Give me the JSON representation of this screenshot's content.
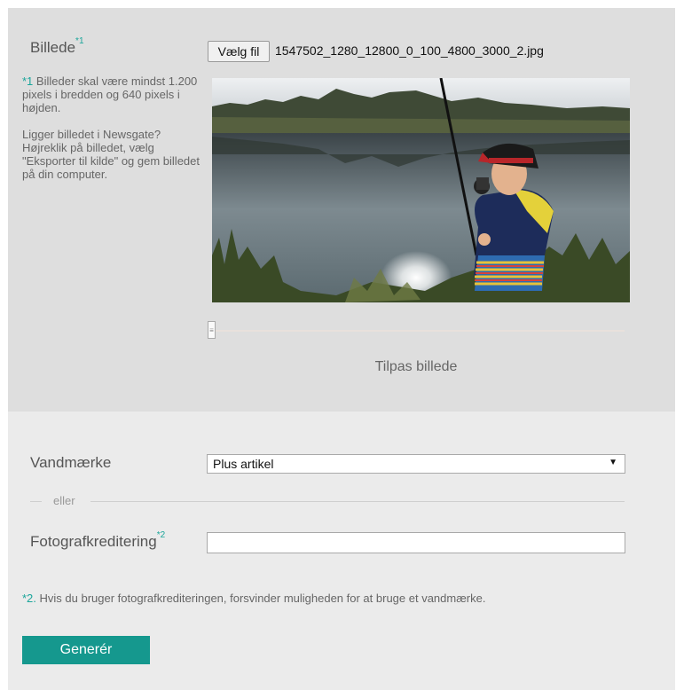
{
  "image_section": {
    "label": "Billede",
    "label_note": "*1",
    "help_note_marker": "*1",
    "help_text_1": "Billeder skal være mindst 1.200 pixels i bredden og 640 pixels i højden.",
    "help_text_2": "Ligger billedet i Newsgate? Højreklik på billedet, vælg \"Eksporter til kilde\" og gem billedet på din computer.",
    "file_button_label": "Vælg fil",
    "file_name": "1547502_1280_12800_0_100_4800_3000_2.jpg",
    "slider_handle_glyph": "≡",
    "fit_label": "Tilpas billede"
  },
  "watermark": {
    "label": "Vandmærke",
    "selected": "Plus artikel",
    "caret_glyph": "▼"
  },
  "divider": {
    "dash": "—",
    "text": "eller"
  },
  "photo_credit": {
    "label": "Fotografkreditering",
    "label_note": "*2",
    "value": ""
  },
  "footnote": {
    "marker": "*2.",
    "text": " Hvis du bruger fotografkrediteringen, forsvinder muligheden for at bruge et vandmærke."
  },
  "generate_button_label": "Generér",
  "colors": {
    "accent": "#1aa59a",
    "button": "#15988e",
    "top_panel": "#dedede",
    "bottom_panel": "#ebebeb"
  }
}
